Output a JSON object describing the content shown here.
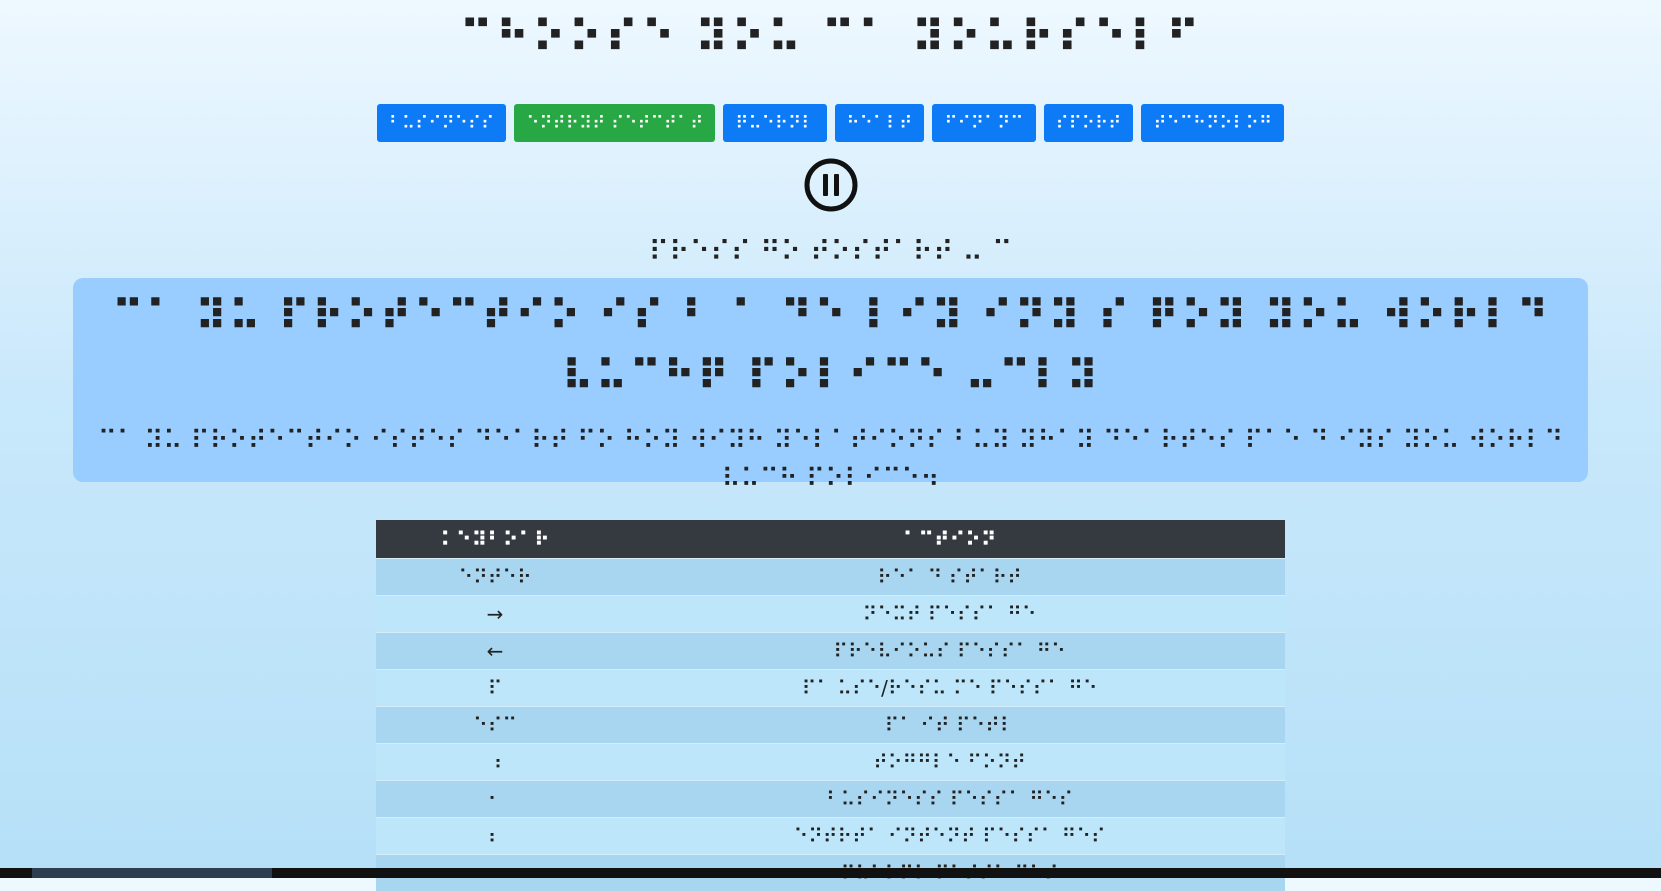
{
  "page_title": "⠉⠓⠕⠕⠎⠑ ⠽⠕⠥ ⠉⠁ ⠽⠕⠥⠗⠎⠑⠇⠋",
  "buttons": [
    {
      "label": "⠃⠥⠎⠊⠝⠑⠎⠎",
      "active": false
    },
    {
      "label": "⠑⠝⠞⠗⠽⠞ ⠎⠑⠞⠉⠞⠁⠞",
      "active": true
    },
    {
      "label": "⠟⠥⠑⠗⠝⠇",
      "active": false
    },
    {
      "label": "⠓⠑⠁⠇⠞",
      "active": false
    },
    {
      "label": "⠋⠊⠝⠁⠝⠉",
      "active": false
    },
    {
      "label": "⠎⠏⠕⠗⠞",
      "active": false
    },
    {
      "label": "⠞⠑⠉⠓⠝⠕⠇⠕⠛",
      "active": false
    }
  ],
  "pause_icon": "pause-circle",
  "status_text": "⠏⠗⠑⠎⠎ ⠛⠕ ⠞⠕⠎⠞⠁⠗⠞ ⠤ ⠉",
  "card": {
    "big_text": "⠉⠁ ⠽⠥ ⠏⠗⠕⠞⠑⠉⠞⠊⠕ ⠊⠎ ⠃ ⠁ ⠙⠑ ⠇⠊⠽ ⠊⠝⠽ ⠎ ⠟⠕⠽ ⠽⠕⠥ ⠺⠕⠗⠇⠙ ⠧⠥⠉⠓⠟ ⠏⠕⠇⠊⠉⠑ ⠤⠉⠇⠽",
    "small_text": "⠉⠁ ⠽⠥ ⠏⠗⠕⠞⠑⠉⠞⠊⠕ ⠊⠎⠞⠑⠎ ⠙⠑⠁⠗⠞ ⠋⠕ ⠓⠕⠽ ⠺⠊⠽⠓ ⠽⠑⠇⠁⠞⠊⠕⠝⠎ ⠃⠥⠽ ⠽⠓⠁⠽ ⠙⠑⠁⠗⠞⠑⠎ ⠏⠁⠑ ⠙ ⠊⠽⠎ ⠽⠕⠥ ⠺⠕⠗⠇⠙ ⠧⠥⠉⠓ ⠏⠕⠇⠊⠉⠑⠲"
  },
  "table": {
    "headers": [
      "⠅⠑⠽⠃⠕⠁⠗",
      "⠁⠉⠞⠊⠕⠝"
    ],
    "rows": [
      [
        "⠑⠝⠞⠑⠗",
        "⠗⠑⠁ ⠙ ⠎⠞⠁⠗⠞"
      ],
      [
        "→",
        "⠝⠑⠭⠞ ⠏⠑⠎⠎⠁ ⠛⠑"
      ],
      [
        "←",
        "⠏⠗⠑⠧⠊⠕⠥⠎ ⠏⠑⠎⠎⠁ ⠛⠑"
      ],
      [
        "⠏",
        "⠏⠁ ⠥⠎⠑/⠗⠑⠎⠥ ⠍⠑ ⠏⠑⠎⠎⠁ ⠛⠑"
      ],
      [
        "⠑⠎⠉",
        "⠏⠁ ⠊⠞ ⠏⠑⠞⠇"
      ],
      [
        "⠰",
        "⠞⠕⠛⠛⠇⠑ ⠋⠕⠝⠞"
      ],
      [
        "⠂",
        "⠃⠥⠎⠊⠝⠑⠎⠎ ⠏⠑⠎⠎⠁ ⠛⠑⠎"
      ],
      [
        "⠆",
        "⠑⠝⠞⠗⠞⠁ ⠊⠝⠞⠑⠝⠞ ⠏⠑⠎⠎⠁ ⠛⠑⠎"
      ],
      [
        "⠒",
        "⠟⠥⠑⠗⠝⠇ ⠏⠑⠎⠎⠁ ⠛⠑⠎"
      ]
    ]
  }
}
